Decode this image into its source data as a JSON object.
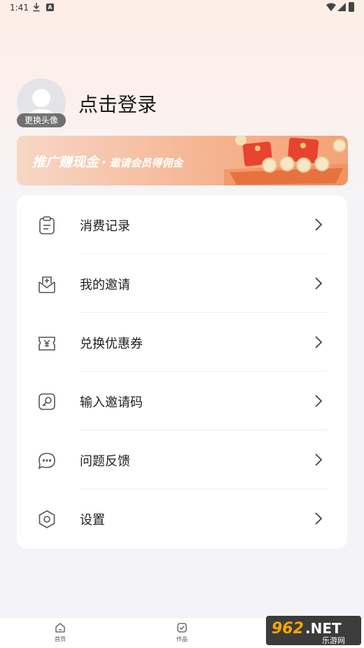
{
  "status_bar": {
    "time": "1:41"
  },
  "profile": {
    "avatar_label": "更换头像",
    "login_text": "点击登录"
  },
  "banner": {
    "main": "推广赚现金",
    "dot": "·",
    "sub": "邀请会员得佣金"
  },
  "menu": [
    {
      "label": "消费记录",
      "icon": "clipboard-icon"
    },
    {
      "label": "我的邀请",
      "icon": "invite-envelope-icon"
    },
    {
      "label": "兑换优惠券",
      "icon": "coupon-icon"
    },
    {
      "label": "输入邀请码",
      "icon": "key-icon"
    },
    {
      "label": "问题反馈",
      "icon": "chat-bubble-icon"
    },
    {
      "label": "设置",
      "icon": "settings-hexagon-icon"
    }
  ],
  "bottom_nav": [
    {
      "label": "首页",
      "icon": "home-icon"
    },
    {
      "label": "作品",
      "icon": "works-icon"
    }
  ],
  "watermark": {
    "text": "962.NET",
    "sub": "乐游网"
  },
  "colors": {
    "accent": "#f5a276",
    "card": "#ffffff",
    "background": "#f4f4f8"
  }
}
